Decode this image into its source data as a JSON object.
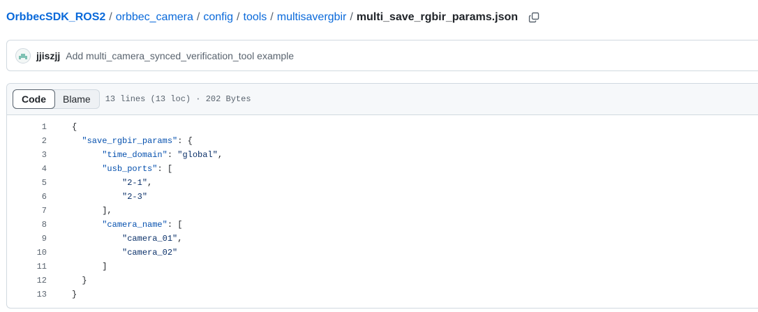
{
  "breadcrumb": {
    "repo": "OrbbecSDK_ROS2",
    "dirs": [
      "orbbec_camera",
      "config",
      "tools",
      "multisavergbir"
    ],
    "separator": "/",
    "file": "multi_save_rgbir_params.json"
  },
  "commit": {
    "author": "jjiszjj",
    "message": "Add multi_camera_synced_verification_tool example"
  },
  "file_view": {
    "tabs": [
      {
        "label": "Code",
        "active": true
      },
      {
        "label": "Blame",
        "active": false
      }
    ],
    "info": "13 lines (13 loc) · 202 Bytes",
    "lines": [
      {
        "num": "1",
        "tokens": [
          {
            "t": "p",
            "v": "{"
          }
        ]
      },
      {
        "num": "2",
        "tokens": [
          {
            "t": "p",
            "v": "  "
          },
          {
            "t": "key",
            "v": "\"save_rgbir_params\""
          },
          {
            "t": "p",
            "v": ": {"
          }
        ]
      },
      {
        "num": "3",
        "tokens": [
          {
            "t": "p",
            "v": "      "
          },
          {
            "t": "key",
            "v": "\"time_domain\""
          },
          {
            "t": "p",
            "v": ": "
          },
          {
            "t": "str",
            "v": "\"global\""
          },
          {
            "t": "p",
            "v": ","
          }
        ]
      },
      {
        "num": "4",
        "tokens": [
          {
            "t": "p",
            "v": "      "
          },
          {
            "t": "key",
            "v": "\"usb_ports\""
          },
          {
            "t": "p",
            "v": ": ["
          }
        ]
      },
      {
        "num": "5",
        "tokens": [
          {
            "t": "p",
            "v": "          "
          },
          {
            "t": "str",
            "v": "\"2-1\""
          },
          {
            "t": "p",
            "v": ","
          }
        ]
      },
      {
        "num": "6",
        "tokens": [
          {
            "t": "p",
            "v": "          "
          },
          {
            "t": "str",
            "v": "\"2-3\""
          }
        ]
      },
      {
        "num": "7",
        "tokens": [
          {
            "t": "p",
            "v": "      ],"
          }
        ]
      },
      {
        "num": "8",
        "tokens": [
          {
            "t": "p",
            "v": "      "
          },
          {
            "t": "key",
            "v": "\"camera_name\""
          },
          {
            "t": "p",
            "v": ": ["
          }
        ]
      },
      {
        "num": "9",
        "tokens": [
          {
            "t": "p",
            "v": "          "
          },
          {
            "t": "str",
            "v": "\"camera_01\""
          },
          {
            "t": "p",
            "v": ","
          }
        ]
      },
      {
        "num": "10",
        "tokens": [
          {
            "t": "p",
            "v": "          "
          },
          {
            "t": "str",
            "v": "\"camera_02\""
          }
        ]
      },
      {
        "num": "11",
        "tokens": [
          {
            "t": "p",
            "v": "      ]"
          }
        ]
      },
      {
        "num": "12",
        "tokens": [
          {
            "t": "p",
            "v": "  }"
          }
        ]
      },
      {
        "num": "13",
        "tokens": [
          {
            "t": "p",
            "v": "}"
          }
        ]
      }
    ]
  },
  "icons": {
    "copy": "copy-icon",
    "avatar": "identicon"
  },
  "colors": {
    "link": "#0969da",
    "json_key": "#0550ae",
    "json_string": "#0a3069",
    "muted": "#59636e",
    "border": "#d1d9e0"
  }
}
